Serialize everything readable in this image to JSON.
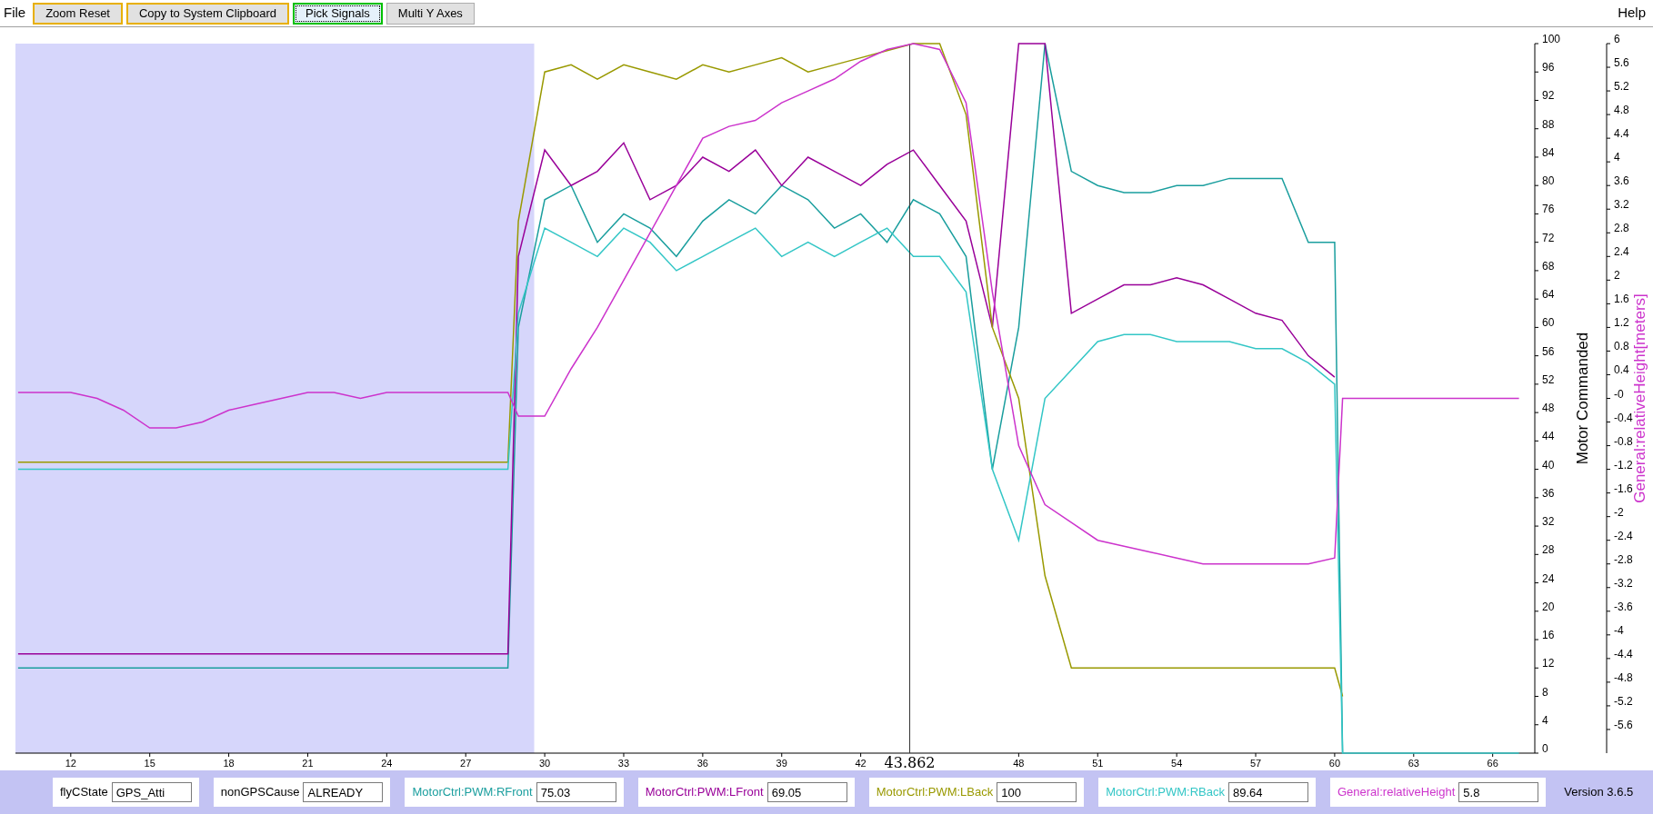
{
  "menu": {
    "left": "File",
    "right": "Help"
  },
  "toolbar": [
    {
      "label": "Zoom Reset",
      "kind": "accent"
    },
    {
      "label": "Copy to System Clipboard",
      "kind": "accent"
    },
    {
      "label": "Pick Signals",
      "kind": "focused"
    },
    {
      "label": "Multi Y Axes",
      "kind": "plain"
    }
  ],
  "plot": {
    "chart_data": {
      "type": "line",
      "ylabel": "Motor Commanded",
      "xlim": [
        9.9,
        67.6
      ],
      "ylim": [
        0,
        100
      ],
      "x": [
        10,
        11,
        12,
        13,
        14,
        15,
        16,
        17,
        18,
        19,
        20,
        21,
        22,
        23,
        24,
        25,
        26,
        27,
        28,
        28.6,
        29,
        30,
        31,
        32,
        33,
        34,
        35,
        36,
        37,
        38,
        39,
        40,
        41,
        42,
        43,
        44,
        45,
        46,
        47,
        48,
        49,
        50,
        51,
        52,
        53,
        54,
        55,
        56,
        57,
        58,
        59,
        60,
        60.3,
        61,
        62,
        63,
        64,
        65,
        66,
        67
      ],
      "xticks": [
        12,
        15,
        18,
        21,
        24,
        27,
        30,
        33,
        36,
        39,
        42,
        48,
        51,
        54,
        57,
        60,
        63,
        66
      ],
      "yticks": [
        0,
        4,
        8,
        12,
        16,
        20,
        24,
        28,
        32,
        36,
        40,
        44,
        48,
        52,
        56,
        60,
        64,
        68,
        72,
        76,
        80,
        84,
        88,
        92,
        96,
        100
      ],
      "series": [
        {
          "color": "#1a9e9e",
          "values": [
            12,
            12,
            12,
            12,
            12,
            12,
            12,
            12,
            12,
            12,
            12,
            12,
            12,
            12,
            12,
            12,
            12,
            12,
            12,
            12,
            60,
            78,
            80,
            72,
            76,
            74,
            70,
            75,
            78,
            76,
            80,
            78,
            74,
            76,
            72,
            78,
            76,
            70,
            40,
            60,
            100,
            82,
            80,
            79,
            79,
            80,
            80,
            81,
            81,
            81,
            72,
            72,
            0,
            null,
            null,
            null,
            null,
            null,
            null,
            null
          ]
        },
        {
          "color": "#990099",
          "values": [
            14,
            14,
            14,
            14,
            14,
            14,
            14,
            14,
            14,
            14,
            14,
            14,
            14,
            14,
            14,
            14,
            14,
            14,
            14,
            14,
            70,
            85,
            80,
            82,
            86,
            78,
            80,
            84,
            82,
            85,
            80,
            84,
            82,
            80,
            83,
            85,
            80,
            75,
            60,
            100,
            100,
            62,
            64,
            66,
            66,
            67,
            66,
            64,
            62,
            61,
            56,
            53,
            null,
            null,
            null,
            null,
            null,
            null,
            null,
            null
          ]
        },
        {
          "color": "#999900",
          "values": [
            41,
            41,
            41,
            41,
            41,
            41,
            41,
            41,
            41,
            41,
            41,
            41,
            41,
            41,
            41,
            41,
            41,
            41,
            41,
            41,
            75,
            96,
            97,
            95,
            97,
            96,
            95,
            97,
            96,
            97,
            98,
            96,
            97,
            98,
            99,
            100,
            100,
            90,
            60,
            50,
            25,
            12,
            12,
            12,
            12,
            12,
            12,
            12,
            12,
            12,
            12,
            12,
            8,
            null,
            null,
            null,
            null,
            null,
            null,
            null
          ]
        },
        {
          "color": "#33c6c6",
          "values": [
            40,
            40,
            40,
            40,
            40,
            40,
            40,
            40,
            40,
            40,
            40,
            40,
            40,
            40,
            40,
            40,
            40,
            40,
            40,
            40,
            62,
            74,
            72,
            70,
            74,
            72,
            68,
            70,
            72,
            74,
            70,
            72,
            70,
            72,
            74,
            70,
            70,
            65,
            40,
            30,
            50,
            54,
            58,
            59,
            59,
            58,
            58,
            58,
            57,
            57,
            55,
            52,
            0,
            0,
            0,
            0,
            0,
            0,
            0,
            0
          ]
        }
      ],
      "bands": [
        {
          "axis": "x",
          "from": 9.9,
          "to": 29.6
        }
      ],
      "ref_lines": [
        {
          "axis": "x",
          "value": 43.862,
          "label": "43.862"
        }
      ]
    }
  },
  "height_axis": {
    "chart_data": {
      "type": "line",
      "ylabel": "General:relativeHeight[meters]",
      "xlim": [
        9.9,
        67.6
      ],
      "ylim": [
        -6,
        6
      ],
      "x": [
        10,
        11,
        12,
        13,
        14,
        15,
        16,
        17,
        18,
        19,
        20,
        21,
        22,
        23,
        24,
        25,
        26,
        27,
        28,
        28.6,
        29,
        30,
        31,
        32,
        33,
        34,
        35,
        36,
        37,
        38,
        39,
        40,
        41,
        42,
        43,
        44,
        45,
        46,
        47,
        48,
        49,
        50,
        51,
        52,
        53,
        54,
        55,
        56,
        57,
        58,
        59,
        60,
        60.3,
        61,
        62,
        63,
        64,
        65,
        66,
        67
      ],
      "yticks": [
        6,
        5.6,
        5.2,
        4.8,
        4.4,
        4,
        3.6,
        3.2,
        2.8,
        2.4,
        2,
        1.6,
        1.2,
        0.8,
        0.4,
        {
          "value": 0,
          "label": "-0"
        },
        -0.4,
        -0.8,
        -1.2,
        -1.6,
        -2,
        -2.4,
        -2.8,
        -3.2,
        -3.6,
        -4,
        -4.4,
        -4.8,
        -5.2,
        -5.6
      ],
      "series": [
        {
          "color": "#cc33cc",
          "values": [
            0.1,
            0.1,
            0.1,
            0,
            -0.2,
            -0.5,
            -0.5,
            -0.4,
            -0.2,
            -0.1,
            0,
            0.1,
            0.1,
            0,
            0.1,
            0.1,
            0.1,
            0.1,
            0.1,
            0.1,
            -0.3,
            -0.3,
            0.5,
            1.2,
            2,
            2.8,
            3.6,
            4.4,
            4.6,
            4.7,
            5,
            5.2,
            5.4,
            5.7,
            5.9,
            6,
            5.9,
            5,
            1.8,
            -0.8,
            -1.8,
            -2.1,
            -2.4,
            -2.5,
            -2.6,
            -2.7,
            -2.8,
            -2.8,
            -2.8,
            -2.8,
            -2.8,
            -2.7,
            0,
            0,
            0,
            0,
            0,
            0,
            0,
            0
          ]
        }
      ]
    }
  },
  "readouts": [
    {
      "label": "flyCState",
      "value": "GPS_Atti",
      "color": "#000000"
    },
    {
      "label": "nonGPSCause",
      "value": "ALREADY",
      "color": "#000000"
    },
    {
      "label": "MotorCtrl:PWM:RFront",
      "value": "75.03",
      "color": "#1a9e9e"
    },
    {
      "label": "MotorCtrl:PWM:LFront",
      "value": "69.05",
      "color": "#990099"
    },
    {
      "label": "MotorCtrl:PWM:LBack",
      "value": "100",
      "color": "#999900"
    },
    {
      "label": "MotorCtrl:PWM:RBack",
      "value": "89.64",
      "color": "#33c6c6"
    },
    {
      "label": "General:relativeHeight",
      "value": "5.8",
      "color": "#cc33cc"
    }
  ],
  "version": "Version 3.6.5"
}
